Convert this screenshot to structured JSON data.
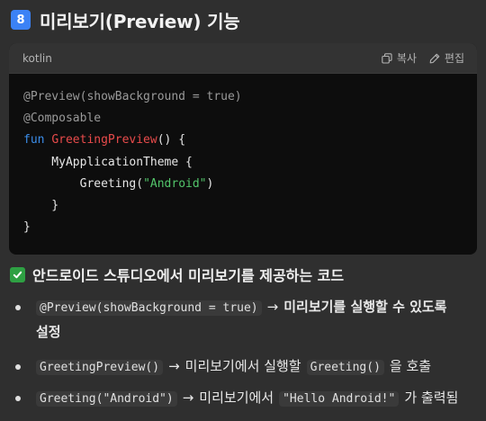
{
  "heading": {
    "number": "8",
    "title": "미리보기(Preview) 기능"
  },
  "codeblock": {
    "language": "kotlin",
    "copy_label": "복사",
    "edit_label": "편집",
    "lines": [
      [
        {
          "t": "@Preview(showBackground = true)",
          "c": "ann"
        }
      ],
      [
        {
          "t": "@Composable",
          "c": "ann"
        }
      ],
      [
        {
          "t": "fun ",
          "c": "kw"
        },
        {
          "t": "GreetingPreview",
          "c": "fn"
        },
        {
          "t": "() {",
          "c": "plain"
        }
      ],
      [
        {
          "t": "    MyApplicationTheme {",
          "c": "plain"
        }
      ],
      [
        {
          "t": "        Greeting(",
          "c": "plain"
        },
        {
          "t": "\"Android\"",
          "c": "str"
        },
        {
          "t": ")",
          "c": "plain"
        }
      ],
      [
        {
          "t": "    }",
          "c": "plain"
        }
      ],
      [
        {
          "t": "}",
          "c": "plain"
        }
      ]
    ]
  },
  "section": {
    "title": "안드로이드 스튜디오에서 미리보기를 제공하는 코드"
  },
  "bullets": {
    "b1": {
      "code": "@Preview(showBackground = true)",
      "arrow": "→",
      "text_line1": "미리보기를 실행할 수 있도록",
      "text_line2": "설정"
    },
    "b2": {
      "code": "GreetingPreview()",
      "arrow": "→",
      "text_mid": "미리보기에서 실행할",
      "code2": "Greeting()",
      "text_end": "을 호출"
    },
    "b3": {
      "code": "Greeting(\"Android\")",
      "arrow": "→",
      "text_mid": "미리보기에서",
      "code2": "\"Hello Android!\"",
      "text_end": "가 출력됨"
    }
  },
  "colors": {
    "background": "#2f2f2f",
    "code_background": "#0d0d0d",
    "badge": "#3b82f6",
    "check": "#2ea043",
    "keyword": "#3b8eea",
    "function_name": "#e94b4b",
    "string": "#52c46a"
  },
  "icons": {
    "copy": "copy-icon",
    "edit": "pencil-icon",
    "check": "check-icon"
  }
}
